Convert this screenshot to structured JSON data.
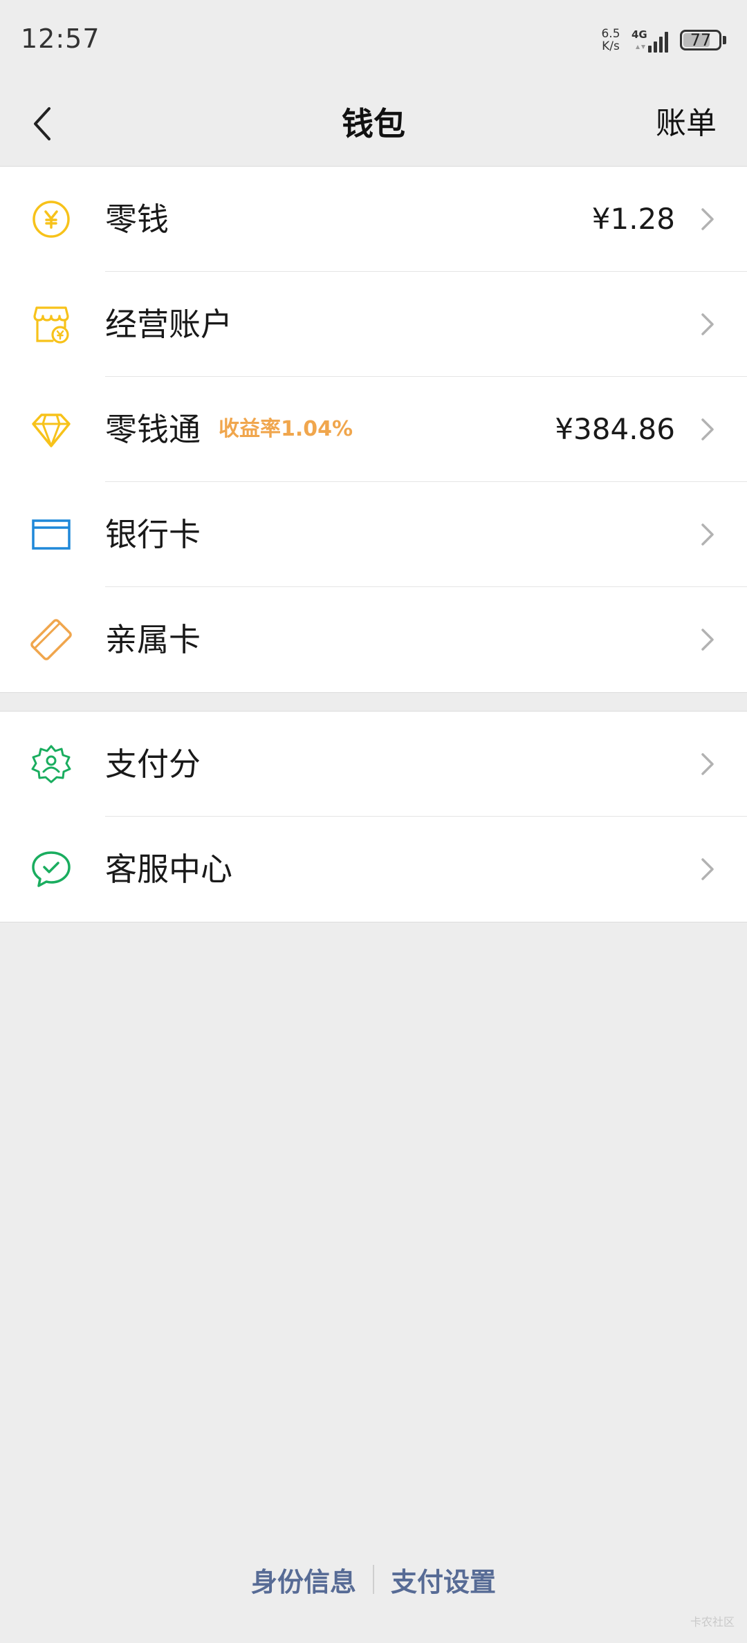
{
  "status_bar": {
    "time": "12:57",
    "net_speed_value": "6.5",
    "net_speed_unit": "K/s",
    "network_type": "4G",
    "battery_level": "77"
  },
  "nav": {
    "title": "钱包",
    "right_action": "账单"
  },
  "groups": [
    {
      "items": [
        {
          "label": "零钱",
          "value": "¥1.28",
          "icon": "yuan-coin-icon",
          "color": "#f7c21a"
        },
        {
          "label": "经营账户",
          "value": "",
          "icon": "shop-account-icon",
          "color": "#f7c21a"
        },
        {
          "label": "零钱通",
          "badge": "收益率1.04%",
          "value": "¥384.86",
          "icon": "diamond-icon",
          "color": "#f7c21a"
        },
        {
          "label": "银行卡",
          "value": "",
          "icon": "bank-card-icon",
          "color": "#1f88d9"
        },
        {
          "label": "亲属卡",
          "value": "",
          "icon": "family-card-icon",
          "color": "#f0a64d"
        }
      ]
    },
    {
      "items": [
        {
          "label": "支付分",
          "value": "",
          "icon": "pay-score-icon",
          "color": "#1aad5f"
        },
        {
          "label": "客服中心",
          "value": "",
          "icon": "customer-service-icon",
          "color": "#1aad5f"
        }
      ]
    }
  ],
  "footer": {
    "identity_link": "身份信息",
    "settings_link": "支付设置"
  },
  "watermark": "卡农社区",
  "colors": {
    "background": "#ededed",
    "link": "#576b95",
    "badge": "#f0a64d"
  }
}
